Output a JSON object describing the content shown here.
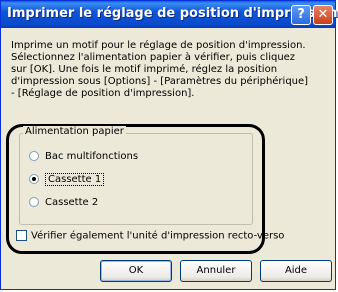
{
  "window": {
    "title": "Imprimer le réglage de position d'impression",
    "help_glyph": "?",
    "close_glyph": "✕"
  },
  "description": "Imprime un motif pour le réglage de position d'impression. Sélectionnez l'alimentation papier à vérifier, puis cliquez sur [OK]. Une fois le motif imprimé, réglez la position d'impression sous [Options] - [Paramètres du périphérique] - [Réglage de position d'impression].",
  "paper_source": {
    "legend": "Alimentation papier",
    "options": [
      "Bac multifonctions",
      "Cassette 1",
      "Cassette 2"
    ],
    "selected": "Cassette 1"
  },
  "duplex_check": {
    "label": "Vérifier également l'unité d'impression recto-verso",
    "checked": false
  },
  "buttons": {
    "ok": "OK",
    "cancel": "Annuler",
    "help": "Aide"
  }
}
